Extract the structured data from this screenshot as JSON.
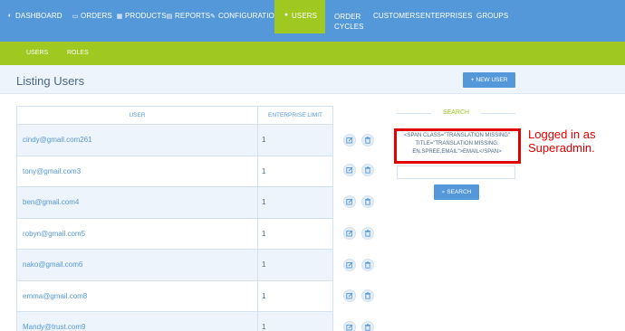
{
  "nav": {
    "items": [
      {
        "label": "DASHBOARD",
        "icon": "dashboard-icon"
      },
      {
        "label": "ORDERS",
        "icon": "cart-icon"
      },
      {
        "label": "PRODUCTS",
        "icon": "products-icon"
      },
      {
        "label": "REPORTS",
        "icon": "file-icon"
      },
      {
        "label": "CONFIGURATION",
        "icon": "wrench-icon"
      },
      {
        "label": "USERS",
        "icon": "user-icon"
      },
      {
        "label_line1": "ORDER",
        "label_line2": "CYCLES"
      },
      {
        "label": "CUSTOMERS"
      },
      {
        "label": "ENTERPRISES"
      },
      {
        "label": "GROUPS"
      }
    ],
    "active": "USERS"
  },
  "subnav": {
    "items": [
      {
        "label": "USERS"
      },
      {
        "label": "ROLES"
      }
    ],
    "active": "USERS"
  },
  "page": {
    "title": "Listing Users",
    "new_user_label": "NEW USER"
  },
  "table": {
    "headers": {
      "user": "USER",
      "limit": "ENTERPRISE LIMIT"
    },
    "rows": [
      {
        "email": "cindy@gmail.com261",
        "limit": "1"
      },
      {
        "email": "tony@gmail.com3",
        "limit": "1"
      },
      {
        "email": "ben@gmail.com4",
        "limit": "1"
      },
      {
        "email": "robyn@gmail.com5",
        "limit": "1"
      },
      {
        "email": "nako@gmail.com6",
        "limit": "1"
      },
      {
        "email": "emma@gmail.com8",
        "limit": "1"
      },
      {
        "email": "Mandy@trust.com9",
        "limit": "1"
      }
    ]
  },
  "search": {
    "title": "SEARCH",
    "label": "<SPAN CLASS=\"TRANSLATION MISSING\" TITLE=\"TRANSLATION MISSING: EN.SPREE.EMAIL\">EMAIL</SPAN>",
    "input_value": "",
    "button_label": "SEARCH"
  },
  "annotation": {
    "line1": "Logged in as",
    "line2": "Superadmin."
  },
  "colors": {
    "primary": "#5498da",
    "accent": "#9fc820",
    "highlight": "#e00000"
  }
}
